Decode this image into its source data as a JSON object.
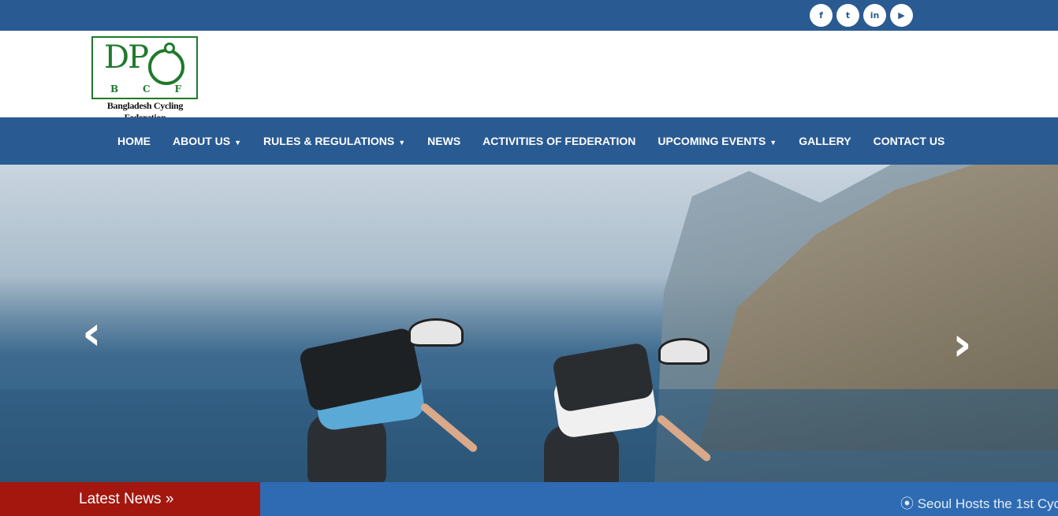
{
  "social": [
    {
      "icon": "facebook-icon",
      "glyph": "f"
    },
    {
      "icon": "twitter-icon",
      "glyph": "t"
    },
    {
      "icon": "linkedin-icon",
      "glyph": "in"
    },
    {
      "icon": "youtube-icon",
      "glyph": "▶"
    }
  ],
  "logo": {
    "letters": [
      "B",
      "C",
      "F"
    ],
    "name": "Bangladesh Cycling Federation"
  },
  "nav": [
    {
      "label": "HOME",
      "dropdown": false
    },
    {
      "label": "ABOUT US",
      "dropdown": true
    },
    {
      "label": "RULES & REGULATIONS",
      "dropdown": true
    },
    {
      "label": "NEWS",
      "dropdown": false
    },
    {
      "label": "ACTIVITIES OF FEDERATION",
      "dropdown": false
    },
    {
      "label": "UPCOMING EVENTS",
      "dropdown": true
    },
    {
      "label": "GALLERY",
      "dropdown": false
    },
    {
      "label": "CONTACT US",
      "dropdown": false
    }
  ],
  "carousel": {
    "prev_glyph": "‹",
    "next_glyph": "›"
  },
  "latest_news": {
    "label": "Latest News »",
    "ticker": "⦿ Seoul Hosts the 1st Cyc"
  },
  "colors": {
    "primary": "#2a5a92",
    "news_label": "#a3170f",
    "ticker": "#2e6bb3",
    "logo_green": "#1f7a2c"
  }
}
